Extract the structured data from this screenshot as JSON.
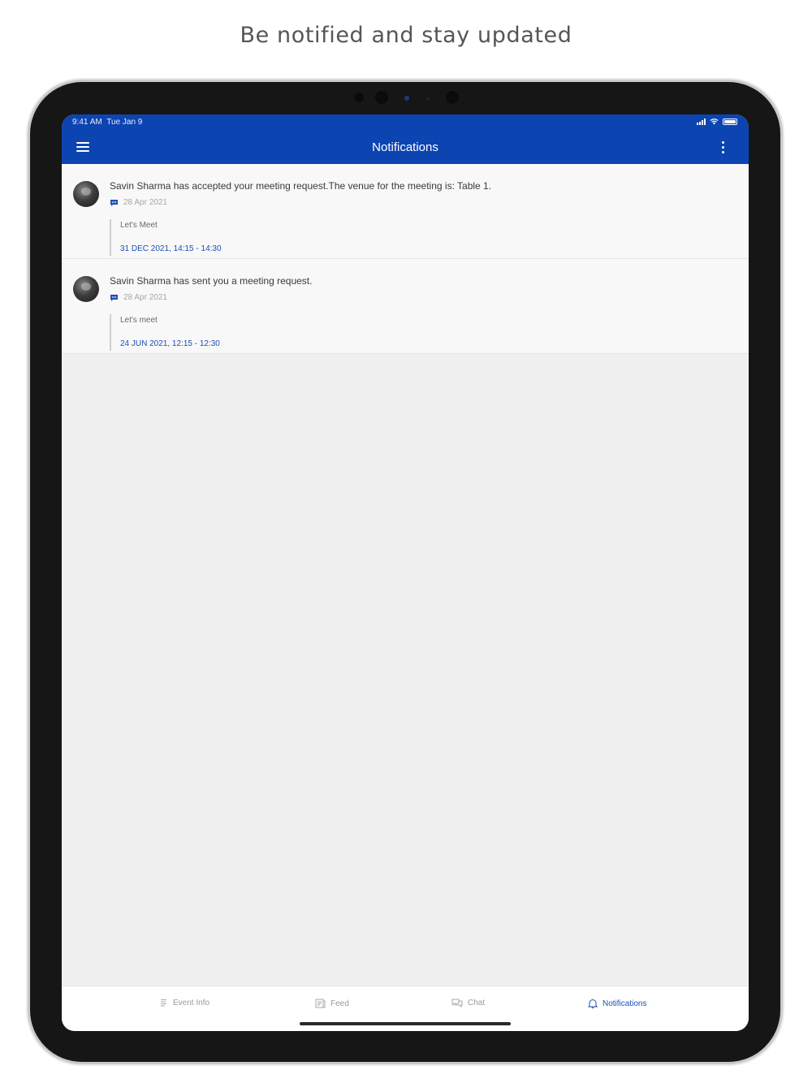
{
  "headline": "Be notified and stay updated",
  "status_bar": {
    "time": "9:41 AM",
    "date": "Tue Jan 9"
  },
  "header": {
    "title": "Notifications"
  },
  "notifications": [
    {
      "text": "Savin Sharma has accepted your meeting request.The venue for the meeting is: Table 1.",
      "date": "28 Apr 2021",
      "message": "Let's Meet",
      "meeting_time": "31 DEC 2021, 14:15 - 14:30"
    },
    {
      "text": "Savin Sharma has sent you a meeting request.",
      "date": "28 Apr 2021",
      "message": "Let's meet",
      "meeting_time": "24 JUN 2021, 12:15 - 12:30"
    }
  ],
  "tabs": [
    {
      "label": "Event Info",
      "icon": "list-icon",
      "active": false
    },
    {
      "label": "Feed",
      "icon": "feed-icon",
      "active": false
    },
    {
      "label": "Chat",
      "icon": "chat-icon",
      "active": false
    },
    {
      "label": "Notifications",
      "icon": "bell-icon",
      "active": true
    }
  ],
  "colors": {
    "primary": "#0c45b2",
    "accent_text": "#1d4db5",
    "background": "#f0f0f0"
  }
}
